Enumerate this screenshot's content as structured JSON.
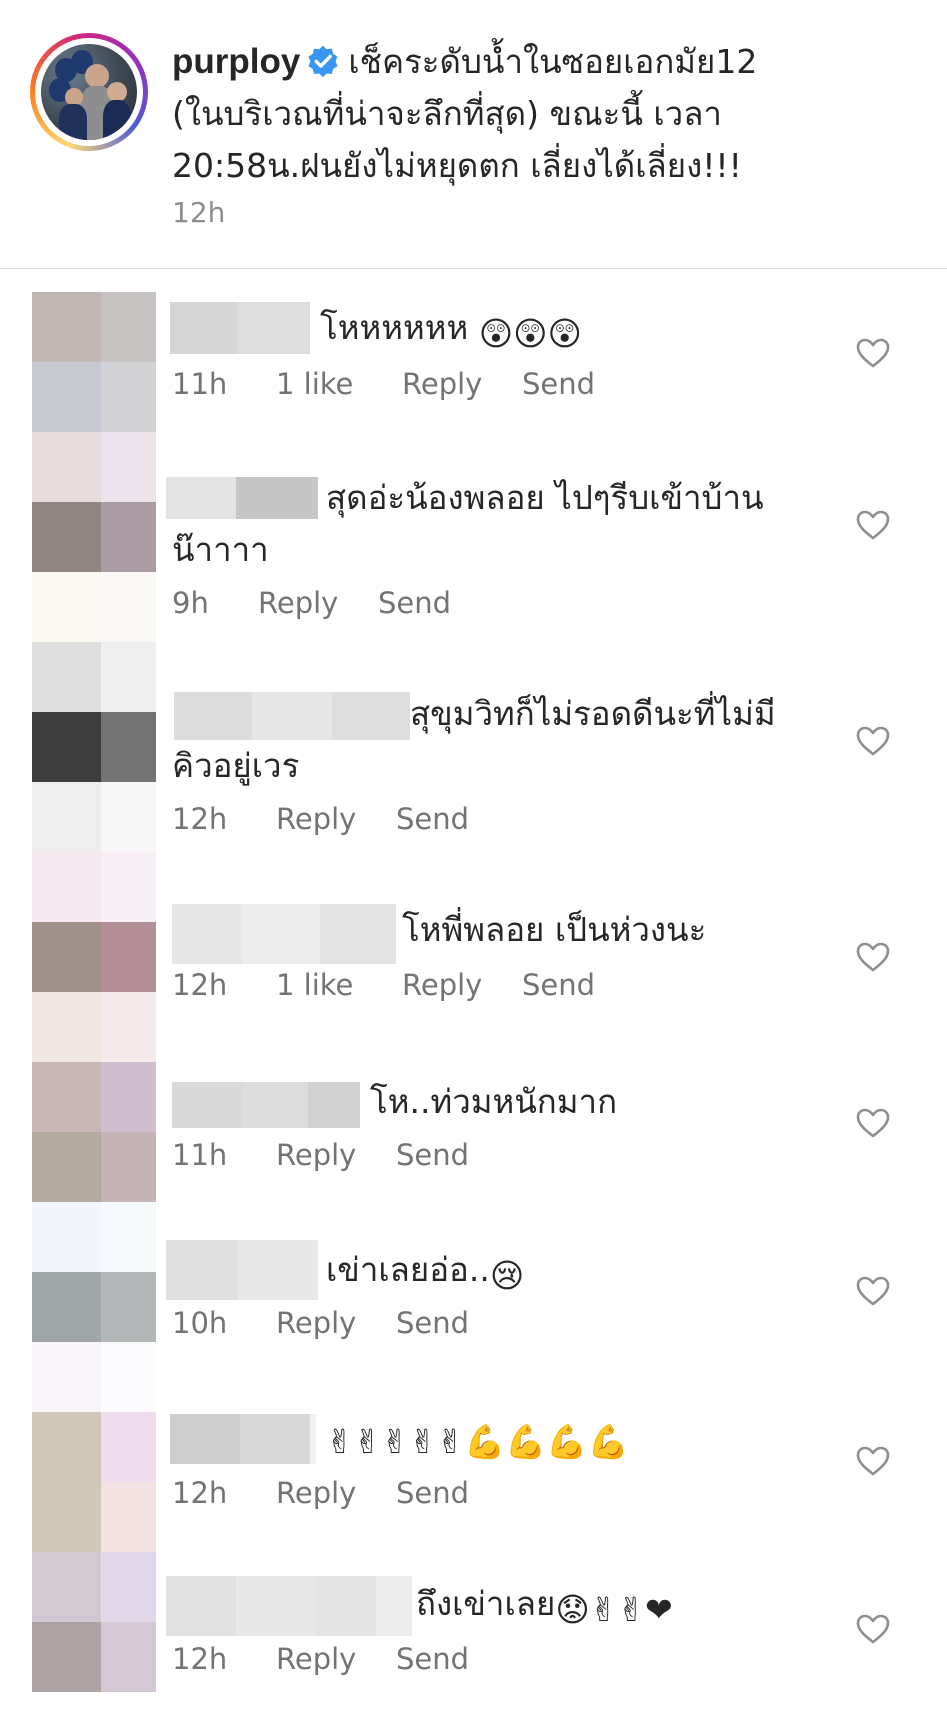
{
  "post": {
    "username": "purploy",
    "caption": "เช็คระดับน้ำในซอยเอกมัย12 (ในบริเวณที่น่าจะลึกที่สุด) ขณะนี้ เวลา 20:58น.ฝนยังไม่หยุดตก เลี่ยงได้เลี่ยง!!!",
    "time": "12h"
  },
  "labels": {
    "reply": "Reply",
    "send": "Send"
  },
  "comments": [
    {
      "text": "โหหหหหห",
      "emojis": "😲😲😲",
      "time": "11h",
      "likes": "1 like"
    },
    {
      "text": "สุดอ่ะน้องพลอย ไปๆรีบเข้าบ้าน",
      "text2": "น๊าาาา",
      "time": "9h"
    },
    {
      "text": "สุขุมวิทก็ไม่รอดดีนะที่ไม่มี",
      "text2": "คิวอยู่เวร",
      "time": "12h"
    },
    {
      "text": "โหพี่พลอย เป็นห่วงนะ",
      "time": "12h",
      "likes": "1 like"
    },
    {
      "text": "โห..ท่วมหนักมาก",
      "time": "11h"
    },
    {
      "text": "เข่าเลยอ่อ..",
      "emojis": "😢",
      "time": "10h"
    },
    {
      "text": "",
      "emojis": "✌✌✌✌✌💪💪💪💪",
      "time": "12h"
    },
    {
      "text": "ถึงเข่าเลย",
      "emojis": "😟✌✌❤",
      "time": "12h"
    }
  ],
  "colors": {
    "accent_blue": "#3897f0",
    "muted": "#737373",
    "text": "#262626"
  },
  "icons": {
    "verified": "verified-badge-icon",
    "like": "heart-outline-icon"
  }
}
